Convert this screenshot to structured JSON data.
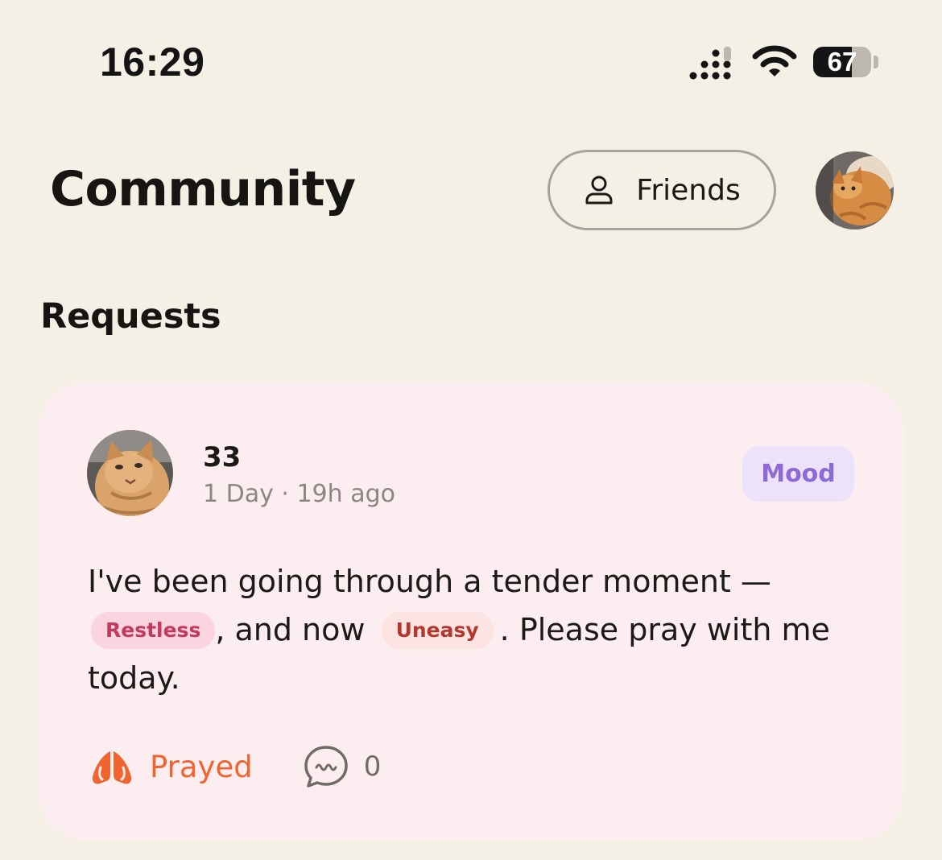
{
  "status_bar": {
    "time": "16:29",
    "battery": "67",
    "battery_level": 0.67,
    "icons": [
      "cellular-signal-icon",
      "wifi-icon",
      "battery-icon"
    ]
  },
  "header": {
    "title": "Community",
    "friends_label": "Friends",
    "friends_icon": "person-icon"
  },
  "section": {
    "title": "Requests"
  },
  "post": {
    "author": "33",
    "time": "1 Day · 19h ago",
    "category": "Mood",
    "text_before": "I've been going through a tender moment — ",
    "tag_1": "Restless",
    "text_middle": ", and now ",
    "tag_2": "Uneasy",
    "text_after": ". Please pray with me today.",
    "prayed_label": "Prayed",
    "comment_count": "0"
  },
  "colors": {
    "background": "#f4f0e6",
    "card": "#fcedf0",
    "accent_orange": "#f0652f",
    "mood_purple": "#8d6ad6",
    "tag_pink": "#c33a5f",
    "tag_red": "#b3382f"
  }
}
